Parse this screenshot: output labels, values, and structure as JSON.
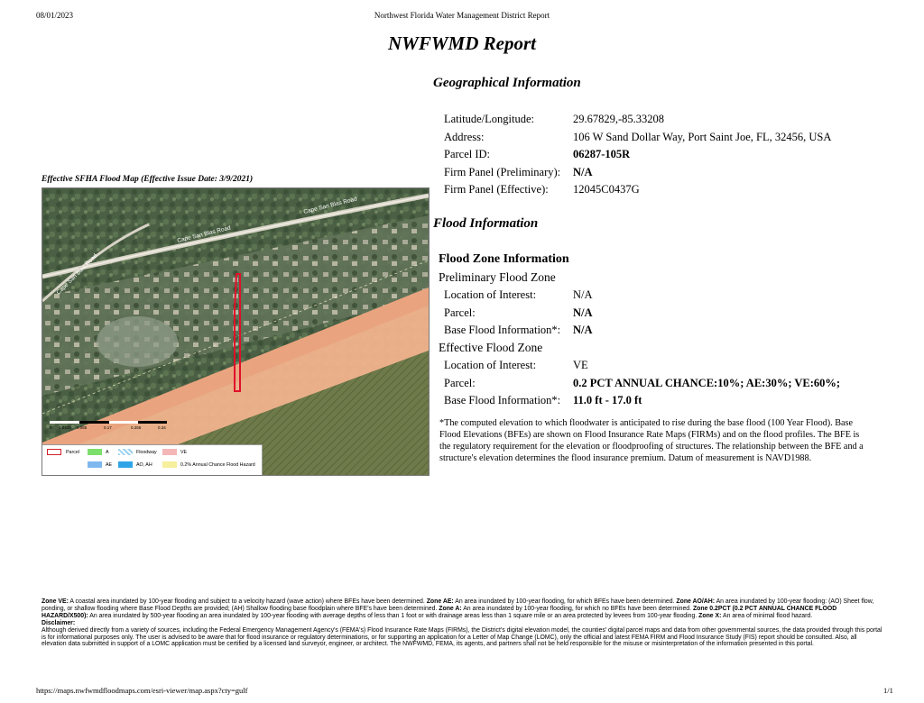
{
  "header": {
    "date": "08/01/2023",
    "center_title": "Northwest Florida Water Management District Report"
  },
  "report_title": "NWFWMD Report",
  "geo": {
    "section_title": "Geographical Information",
    "rows": [
      {
        "label": "Latitude/Longitude:",
        "value": "29.67829,-85.33208"
      },
      {
        "label": "Address:",
        "value": "106 W Sand Dollar Way, Port Saint Joe, FL, 32456, USA"
      },
      {
        "label": "Parcel ID:",
        "value": "06287-105R"
      },
      {
        "label": "Firm Panel (Preliminary):",
        "value": "N/A"
      },
      {
        "label": "Firm Panel (Effective):",
        "value": "12045C0437G"
      }
    ]
  },
  "flood": {
    "section_title": "Flood Information",
    "zone_info_title": "Flood Zone Information",
    "preliminary": {
      "title": "Preliminary Flood Zone",
      "rows": [
        {
          "label": "Location of Interest:",
          "value": "N/A"
        },
        {
          "label": "Parcel:",
          "value": "N/A"
        },
        {
          "label": "Base Flood Information*:",
          "value": "N/A"
        }
      ]
    },
    "effective": {
      "title": "Effective Flood Zone",
      "rows": [
        {
          "label": "Location of Interest:",
          "value": "VE"
        },
        {
          "label": "Parcel:",
          "value": "0.2 PCT ANNUAL CHANCE:10%; AE:30%; VE:60%;"
        },
        {
          "label": "Base Flood Information*:",
          "value": "11.0 ft - 17.0 ft"
        }
      ]
    },
    "note": "*The computed elevation to which floodwater is anticipated to rise during the base flood (100 Year Flood). Base Flood Elevations (BFEs) are shown on Flood Insurance Rate Maps (FIRMs) and on the flood profiles. The BFE is the regulatory requirement for the elevation or floodproofing of structures. The relationship between the BFE and a structure's elevation determines the flood insurance premium. Datum of measurement is NAVD1988."
  },
  "map": {
    "caption": "Effective SFHA Flood Map (Effective Issue Date: 3/9/2021)",
    "road_labels": [
      "Cape San Blas Road",
      "Cape San Blas Road",
      "Cape San Blas Road"
    ],
    "scale_labels": [
      "0",
      "0.0425",
      "0.085",
      "0.17",
      "0.255",
      "0.34"
    ],
    "legend": [
      {
        "label": "Parcel",
        "color": "#ffffff",
        "border": "#d0202a"
      },
      {
        "label": "A",
        "color": "#7ddf6b"
      },
      {
        "label": "Floodway",
        "color": "#cfe8f5"
      },
      {
        "label": "VE",
        "color": "#f4b6b6"
      },
      {
        "label": "AE",
        "color": "#7fb7ef"
      },
      {
        "label": "AO, AH",
        "color": "#2fa4e7"
      },
      {
        "label": "0.2% Annual Chance Flood Hazard",
        "color": "#f6ef9b"
      }
    ],
    "colors": {
      "ve": "#f1b38d",
      "parcel": "#e0102a",
      "land": "#4f6a4b",
      "water": "#5b6b45"
    }
  },
  "footer": {
    "ve_label": "Zone VE:",
    "ve_text": " A coastal area inundated by 100-year flooding and subject to a velocity hazard (wave action) where BFEs have been determined. ",
    "ae_label": "Zone AE:",
    "ae_text": " An area inundated by 100-year flooding, for which BFEs have been determined. ",
    "aoah_label": "Zone AO/AH:",
    "aoah_text": " An area inundated by 100-year flooding: (AO) Sheet flow, ponding, or shallow flooding where Base Flood Depths are provided; (AH) Shallow flooding base floodplain where BFE's have been determined. ",
    "a_label": "Zone A:",
    "a_text": " An area inundated by 100-year flooding, for which no BFEs have been determined. ",
    "pct_label": "Zone 0.2PCT (0.2 PCT ANNUAL CHANCE FLOOD HAZARD/X500):",
    "pct_text": " An area inundated by 500-year flooding an area inundated by 100-year flooding with average depths of less than 1 foot or with drainage areas less than 1 square mile or an area protected by levees from 100-year flooding. ",
    "x_label": "Zone X:",
    "x_text": " An area of minimal flood hazard.",
    "disclaimer_label": "Disclaimer:",
    "disclaimer_text": "Although derived directly from a variety of sources, including the Federal Emergency Management Agency's (FEMA's) Flood Insurance Rate Maps (FIRMs), the District's digital elevation model, the counties' digital parcel maps and data from other governmental sources, the data provided through this portal is for informational purposes only. The user is advised to be aware that for flood insurance or regulatory determinations, or for supporting an application for a Letter of Map Change (LOMC), only the official and latest FEMA FIRM and Flood Insurance Study (FIS) report should be consulted. Also, all elevation data submitted in support of a LOMC application must be certified by a licensed land surveyor, engineer, or architect. The NWFWMD, FEMA, its agents, and partners shall not be held responsible for the misuse or misinterpretation of the information presented in this portal.",
    "url": "https://maps.nwfwmdfloodmaps.com/esri-viewer/map.aspx?cty=gulf",
    "page": "1/1"
  }
}
